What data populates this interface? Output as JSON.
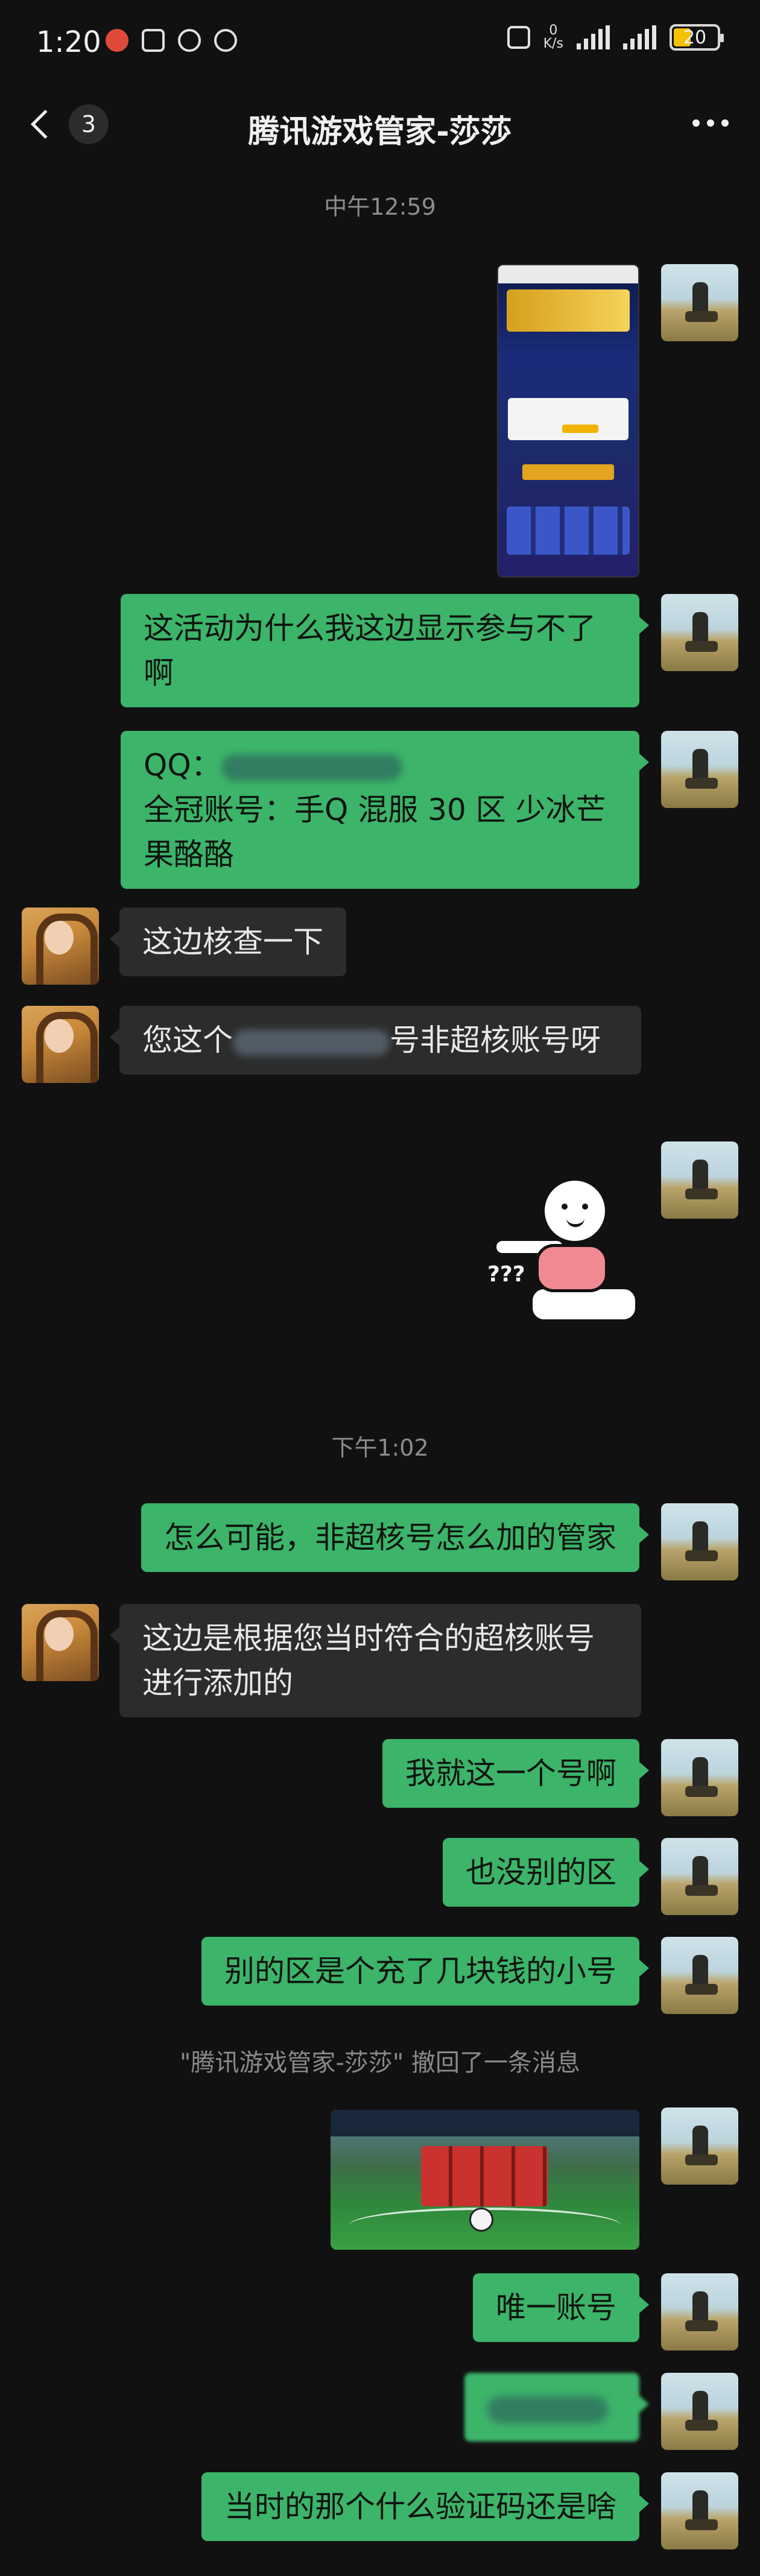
{
  "status_bar": {
    "time": "1:20",
    "net_speed_value": "0",
    "net_speed_unit": "K/s",
    "battery": "20"
  },
  "nav": {
    "unread_count": "3",
    "title": "腾讯游戏管家-莎莎"
  },
  "timestamps": {
    "t1": "中午12:59",
    "t2": "下午1:02"
  },
  "messages": {
    "m1": "这活动为什么我这边显示参与不了啊",
    "m2_qq_label": "QQ：",
    "m2_account": "全冠账号：手Q 混服 30 区 少冰芒果酪酪",
    "m3": "这边核查一下",
    "m4_prefix": "您这个",
    "m4_suffix": "号非超核账号呀",
    "m5": "怎么可能，非超核号怎么加的管家",
    "m6": "这边是根据您当时符合的超核账号进行添加的",
    "m7": "我就这一个号啊",
    "m8": "也没别的区",
    "m9": "别的区是个充了几块钱的小号",
    "m10": "唯一账号",
    "m11": "当时的那个什么验证码还是啥"
  },
  "recall_notice": "\"腾讯游戏管家-莎莎\" 撤回了一条消息"
}
